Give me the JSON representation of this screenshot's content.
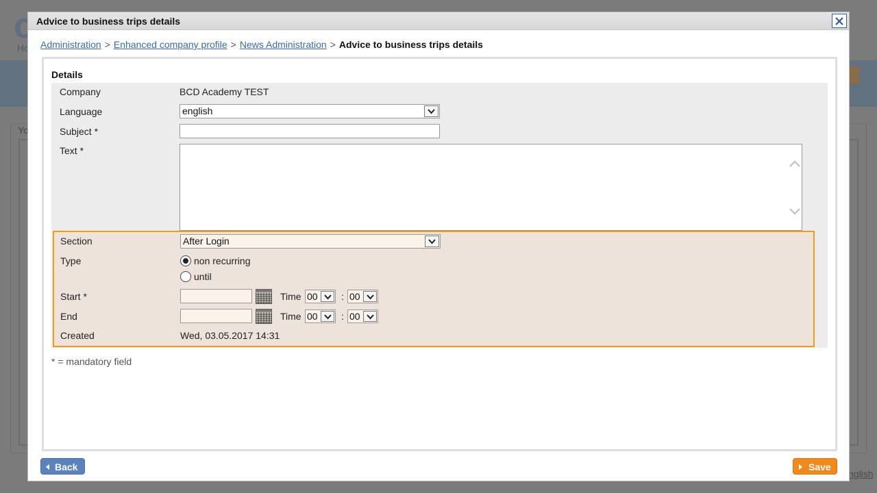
{
  "background": {
    "logo_text": "ci",
    "nav_fragment": "Ho",
    "heading_fragment": "Yo",
    "language_link": "nglish"
  },
  "dialog": {
    "title": "Advice to business trips details",
    "close_symbol": "✕"
  },
  "breadcrumb": {
    "items": [
      "Administration",
      "Enhanced company profile",
      "News Administration"
    ],
    "separator": ">",
    "current": "Advice to business trips details"
  },
  "details": {
    "title": "Details",
    "company_label": "Company",
    "company_value": "BCD Academy TEST",
    "language_label": "Language",
    "language_value": "english",
    "subject_label": "Subject *",
    "subject_value": "",
    "text_label": "Text *",
    "text_value": ""
  },
  "schedule": {
    "section_label": "Section",
    "section_value": "After Login",
    "type_label": "Type",
    "type_options": [
      {
        "label": "non recurring",
        "checked": true
      },
      {
        "label": "until",
        "checked": false
      }
    ],
    "start_label": "Start *",
    "start_value": "",
    "end_label": "End",
    "end_value": "",
    "time_label": "Time",
    "time_separator": ":",
    "start_hour": "00",
    "start_minute": "00",
    "end_hour": "00",
    "end_minute": "00",
    "created_label": "Created",
    "created_value": "Wed, 03.05.2017 14:31"
  },
  "footnote": "* = mandatory field",
  "buttons": {
    "back": "Back",
    "save": "Save"
  },
  "colors": {
    "accent_orange": "#f29a1a",
    "link_blue": "#3a6aa4",
    "back_button": "#5b82bc",
    "save_button": "#f18a1c"
  }
}
